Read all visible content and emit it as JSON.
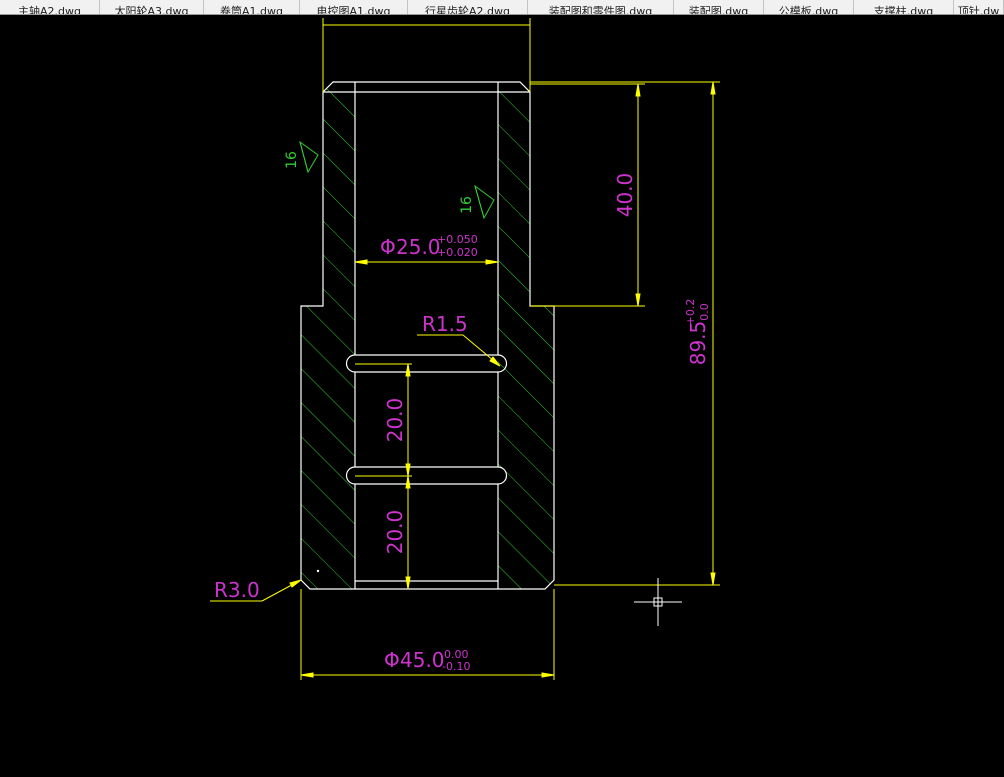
{
  "tabs": [
    {
      "label": "主轴A2.dwg"
    },
    {
      "label": "太阳轮A3.dwg"
    },
    {
      "label": "卷筒A1.dwg"
    },
    {
      "label": "电控图A1.dwg"
    },
    {
      "label": "行星齿轮A2.dwg"
    },
    {
      "label": "装配图和零件图.dwg"
    },
    {
      "label": "装配图.dwg"
    },
    {
      "label": "公模板.dwg"
    },
    {
      "label": "支撑柱.dwg"
    },
    {
      "label": "顶针.dw"
    }
  ],
  "drawing": {
    "colors": {
      "background": "#000000",
      "outline": "#ffffff",
      "dimension": "#ffff00",
      "hatch": "#33cc33",
      "text": "#cc33cc",
      "roughness": "#33cc33",
      "crosshair": "#ffffff"
    },
    "dim_inner_diameter": {
      "symbol": "Φ",
      "value": "25.0",
      "upper": "+0.050",
      "lower": "+0.020"
    },
    "dim_outer_diameter": {
      "symbol": "Φ",
      "value": "45.0",
      "upper": "0.00",
      "lower": "-0.10"
    },
    "dim_total_height": {
      "value": "89.5",
      "upper": "+0.2",
      "lower": "0.0"
    },
    "dim_step_height": "40.0",
    "dim_groove_spacing_upper": "20.0",
    "dim_groove_spacing_lower": "20.0",
    "radius_groove": "R1.5",
    "radius_corner": "R3.0",
    "roughness_outer": "16",
    "roughness_inner": "16"
  }
}
